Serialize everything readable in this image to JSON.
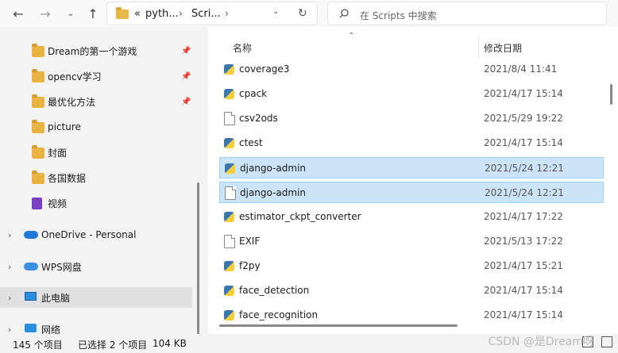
{
  "nav": {
    "back_icon": "back-arrow-icon",
    "forward_icon": "forward-arrow-icon",
    "recent_icon": "chevron-down-icon",
    "up_icon": "up-arrow-icon"
  },
  "address": {
    "overflow": "«",
    "crumbs": [
      "pyth...",
      "Scri..."
    ],
    "refresh_icon": "refresh-icon"
  },
  "search": {
    "placeholder": "在 Scripts 中搜索"
  },
  "sidebar": {
    "items": [
      {
        "label": "Dream的第一个游戏",
        "pinned": true
      },
      {
        "label": "opencv学习",
        "pinned": true
      },
      {
        "label": "最优化方法",
        "pinned": true
      },
      {
        "label": "picture"
      },
      {
        "label": "封面"
      },
      {
        "label": "各国数据"
      },
      {
        "label": "视频"
      },
      {
        "label": "OneDrive - Personal"
      },
      {
        "label": "WPS网盘"
      },
      {
        "label": "此电脑"
      },
      {
        "label": "网络"
      }
    ]
  },
  "columns": {
    "name": "名称",
    "date": "修改日期"
  },
  "files": [
    {
      "name": "coverage3",
      "date": "2021/8/4 11:41",
      "type": "py",
      "selected": false
    },
    {
      "name": "cpack",
      "date": "2021/4/17 15:14",
      "type": "py",
      "selected": false
    },
    {
      "name": "csv2ods",
      "date": "2021/5/29 19:22",
      "type": "doc",
      "selected": false
    },
    {
      "name": "ctest",
      "date": "2021/4/17 15:14",
      "type": "py",
      "selected": false
    },
    {
      "name": "django-admin",
      "date": "2021/5/24 12:21",
      "type": "py",
      "selected": true
    },
    {
      "name": "django-admin",
      "date": "2021/5/24 12:21",
      "type": "doc",
      "selected": true
    },
    {
      "name": "estimator_ckpt_converter",
      "date": "2021/4/17 17:22",
      "type": "py",
      "selected": false
    },
    {
      "name": "EXIF",
      "date": "2021/5/13 17:22",
      "type": "doc",
      "selected": false
    },
    {
      "name": "f2py",
      "date": "2021/4/17 15:21",
      "type": "py",
      "selected": false
    },
    {
      "name": "face_detection",
      "date": "2021/4/17 15:14",
      "type": "py",
      "selected": false
    },
    {
      "name": "face_recognition",
      "date": "2021/4/17 15:14",
      "type": "py",
      "selected": false
    }
  ],
  "status": {
    "count": "145 个项目",
    "selected": "已选择 2 个项目",
    "size": "104 KB"
  },
  "watermark": "CSDN @是Dream呀"
}
